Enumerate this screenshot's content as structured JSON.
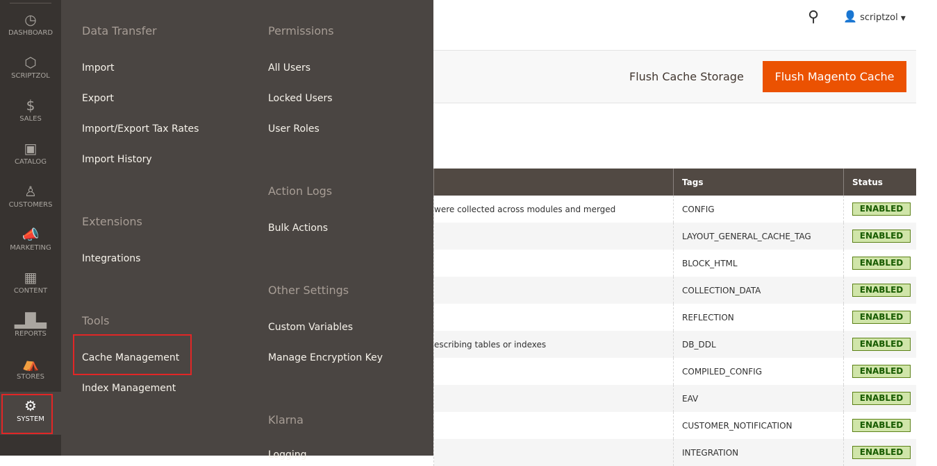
{
  "sidebar": {
    "items": [
      {
        "label": "DASHBOARD",
        "icon": "dashboard-icon"
      },
      {
        "label": "SCRIPTZOL",
        "icon": "hexagon-icon"
      },
      {
        "label": "SALES",
        "icon": "dollar-icon"
      },
      {
        "label": "CATALOG",
        "icon": "box-icon"
      },
      {
        "label": "CUSTOMERS",
        "icon": "person-icon"
      },
      {
        "label": "MARKETING",
        "icon": "megaphone-icon"
      },
      {
        "label": "CONTENT",
        "icon": "layout-icon"
      },
      {
        "label": "REPORTS",
        "icon": "bar-chart-icon"
      },
      {
        "label": "STORES",
        "icon": "store-icon"
      },
      {
        "label": "SYSTEM",
        "icon": "gear-icon"
      }
    ]
  },
  "menu": {
    "data_transfer": {
      "title": "Data Transfer",
      "items": [
        "Import",
        "Export",
        "Import/Export Tax Rates",
        "Import History"
      ]
    },
    "extensions": {
      "title": "Extensions",
      "items": [
        "Integrations"
      ]
    },
    "tools": {
      "title": "Tools",
      "items": [
        "Cache Management",
        "Index Management"
      ]
    },
    "permissions": {
      "title": "Permissions",
      "items": [
        "All Users",
        "Locked Users",
        "User Roles"
      ]
    },
    "action_logs": {
      "title": "Action Logs",
      "items": [
        "Bulk Actions"
      ]
    },
    "other_settings": {
      "title": "Other Settings",
      "items": [
        "Custom Variables",
        "Manage Encryption Key"
      ]
    },
    "klarna": {
      "title": "Klarna",
      "items": [
        "Logging"
      ]
    }
  },
  "header": {
    "username": "scriptzol"
  },
  "actions": {
    "flush_storage": "Flush Cache Storage",
    "flush_magento": "Flush Magento Cache"
  },
  "table": {
    "headers": [
      "",
      "Tags",
      "Status"
    ],
    "rows": [
      [
        "were collected across modules and merged",
        "CONFIG",
        "ENABLED"
      ],
      [
        "",
        "LAYOUT_GENERAL_CACHE_TAG",
        "ENABLED"
      ],
      [
        "",
        "BLOCK_HTML",
        "ENABLED"
      ],
      [
        "",
        "COLLECTION_DATA",
        "ENABLED"
      ],
      [
        "",
        "REFLECTION",
        "ENABLED"
      ],
      [
        "escribing tables or indexes",
        "DB_DDL",
        "ENABLED"
      ],
      [
        "",
        "COMPILED_CONFIG",
        "ENABLED"
      ],
      [
        "",
        "EAV",
        "ENABLED"
      ],
      [
        "",
        "CUSTOMER_NOTIFICATION",
        "ENABLED"
      ],
      [
        "",
        "INTEGRATION",
        "ENABLED"
      ]
    ]
  },
  "colors": {
    "accent": "#eb5202",
    "sidebar": "#373330",
    "flyout": "#4a4542",
    "enabled_bg": "#d0e5a9",
    "highlight": "#e22626"
  }
}
